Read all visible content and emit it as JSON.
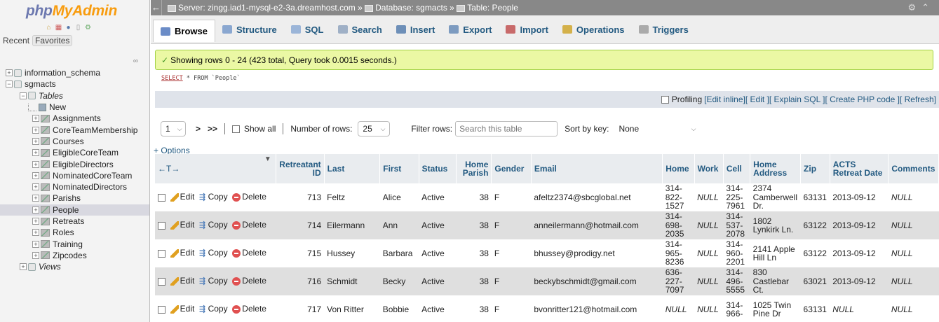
{
  "logo": {
    "part1": "php",
    "part2": "MyAdmin"
  },
  "nav_tabs": {
    "recent": "Recent",
    "favorites": "Favorites"
  },
  "tree": {
    "databases": [
      {
        "name": "information_schema"
      },
      {
        "name": "sgmacts"
      }
    ],
    "tables_label": "Tables",
    "new_label": "New",
    "tables": [
      "Assignments",
      "CoreTeamMembership",
      "Courses",
      "EligibleCoreTeam",
      "EligibleDirectors",
      "NominatedCoreTeam",
      "NominatedDirectors",
      "Parishs",
      "People",
      "Retreats",
      "Roles",
      "Training",
      "Zipcodes"
    ],
    "views_label": "Views"
  },
  "topbar": {
    "server_label": "Server: zingg.iad1-mysql-e2-3a.dreamhost.com »",
    "database_label": "Database: sgmacts »",
    "table_label": "Table: People"
  },
  "tabs": [
    {
      "label": "Browse",
      "icon": "browse-icon",
      "color": "#6b8cc7"
    },
    {
      "label": "Structure",
      "icon": "structure-icon",
      "color": "#8aa7d0"
    },
    {
      "label": "SQL",
      "icon": "sql-icon",
      "color": "#9bb5d8"
    },
    {
      "label": "Search",
      "icon": "search-icon",
      "color": "#9fb0c6"
    },
    {
      "label": "Insert",
      "icon": "insert-icon",
      "color": "#6d8fb8"
    },
    {
      "label": "Export",
      "icon": "export-icon",
      "color": "#7d9bc0"
    },
    {
      "label": "Import",
      "icon": "import-icon",
      "color": "#c86a6a"
    },
    {
      "label": "Operations",
      "icon": "operations-icon",
      "color": "#d4b14a"
    },
    {
      "label": "Triggers",
      "icon": "triggers-icon",
      "color": "#aaaaaa"
    }
  ],
  "message": "Showing rows 0 - 24 (423 total, Query took 0.0015 seconds.)",
  "sql": {
    "select": "SELECT",
    "rest": " * FROM `People`"
  },
  "profiling": {
    "label": "Profiling",
    "links": [
      "[Edit inline]",
      "[ Edit ]",
      "[ Explain SQL ]",
      "[ Create PHP code ]",
      "[ Refresh]"
    ]
  },
  "navigation": {
    "page": "1",
    "next": ">",
    "last": ">>",
    "show_all": "Show all",
    "rows_label": "Number of rows:",
    "rows_value": "25",
    "filter_label": "Filter rows:",
    "filter_placeholder": "Search this table",
    "sort_label": "Sort by key:",
    "sort_value": "None"
  },
  "options_label": "+ Options",
  "columns": [
    "Retreatant ID",
    "Last",
    "First",
    "Status",
    "Home Parish",
    "Gender",
    "Email",
    "Home",
    "Work",
    "Cell",
    "Home Address",
    "Zip",
    "ACTS Retreat Date",
    "Comments"
  ],
  "actions": {
    "edit": "Edit",
    "copy": "Copy",
    "delete": "Delete"
  },
  "rows": [
    {
      "id": "713",
      "last": "Feltz",
      "first": "Alice",
      "status": "Active",
      "parish": "38",
      "gender": "F",
      "email": "afeltz2374@sbcglobal.net",
      "home": "314-822-1527",
      "work": "NULL",
      "cell": "314-225-7961",
      "address": "2374 Camberwell Dr.",
      "zip": "63131",
      "date": "2013-09-12",
      "comments": "NULL"
    },
    {
      "id": "714",
      "last": "Eilermann",
      "first": "Ann",
      "status": "Active",
      "parish": "38",
      "gender": "F",
      "email": "anneilermann@hotmail.com",
      "home": "314-698-2035",
      "work": "NULL",
      "cell": "314-537-2078",
      "address": "1802 Lynkirk Ln.",
      "zip": "63122",
      "date": "2013-09-12",
      "comments": "NULL"
    },
    {
      "id": "715",
      "last": "Hussey",
      "first": "Barbara",
      "status": "Active",
      "parish": "38",
      "gender": "F",
      "email": "bhussey@prodigy.net",
      "home": "314-965-8236",
      "work": "NULL",
      "cell": "314-960-2201",
      "address": "2141 Apple Hill Ln",
      "zip": "63122",
      "date": "2013-09-12",
      "comments": "NULL"
    },
    {
      "id": "716",
      "last": "Schmidt",
      "first": "Becky",
      "status": "Active",
      "parish": "38",
      "gender": "F",
      "email": "beckybschmidt@gmail.com",
      "home": "636-227-7097",
      "work": "NULL",
      "cell": "314-496-5555",
      "address": "830 Castlebar Ct.",
      "zip": "63021",
      "date": "2013-09-12",
      "comments": "NULL"
    },
    {
      "id": "717",
      "last": "Von Ritter",
      "first": "Bobbie",
      "status": "Active",
      "parish": "38",
      "gender": "F",
      "email": "bvonritter121@hotmail.com",
      "home": "NULL",
      "work": "NULL",
      "cell": "314-966-",
      "address": "1025 Twin Pine Dr",
      "zip": "63131",
      "date": "NULL",
      "comments": "NULL"
    }
  ]
}
